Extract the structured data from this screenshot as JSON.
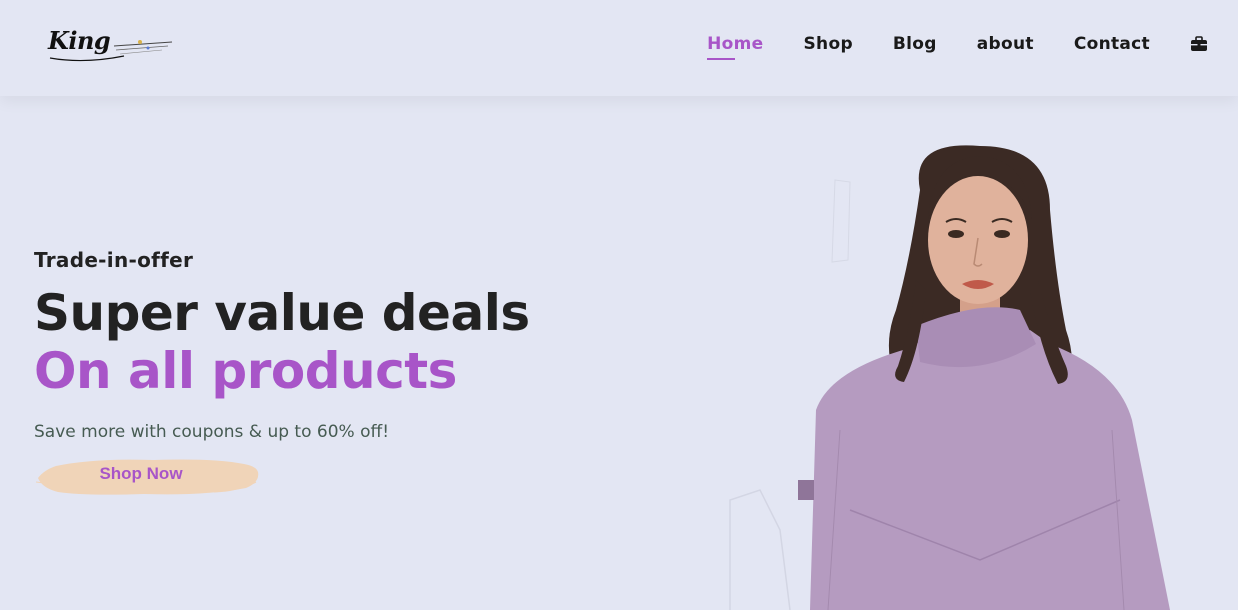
{
  "header": {
    "logo_text": "King",
    "nav": [
      {
        "label": "Home",
        "active": true
      },
      {
        "label": "Shop",
        "active": false
      },
      {
        "label": "Blog",
        "active": false
      },
      {
        "label": "about",
        "active": false
      },
      {
        "label": "Contact",
        "active": false
      }
    ],
    "cart_icon": "briefcase-bag-icon"
  },
  "hero": {
    "kicker": "Trade-in-offer",
    "headline_line1": "Super value deals",
    "headline_line2": "On all products",
    "subtext": "Save more with coupons & up to 60% off!",
    "button_label": "Shop Now"
  },
  "colors": {
    "background": "#e3e6f3",
    "accent": "#a855c8",
    "button_brush": "#f0d4b8",
    "jacket": "#b59bc0"
  }
}
